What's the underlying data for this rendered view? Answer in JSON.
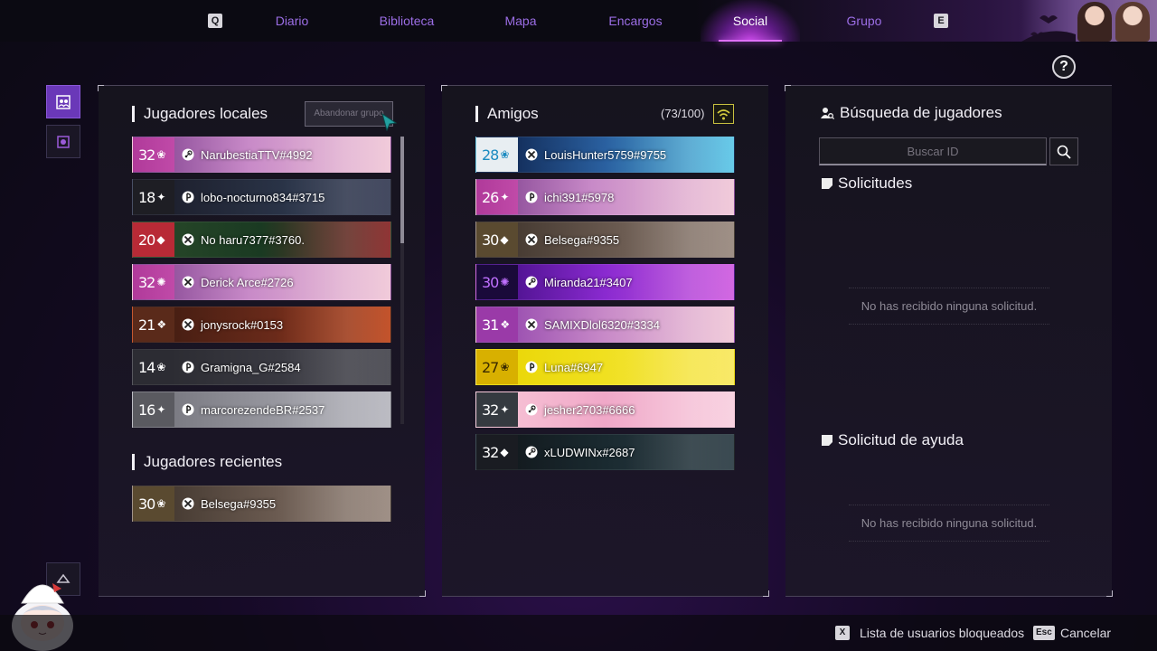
{
  "nav": {
    "left_key": "Q",
    "right_key": "E",
    "tabs": [
      {
        "label": "Diario"
      },
      {
        "label": "Biblioteca"
      },
      {
        "label": "Mapa"
      },
      {
        "label": "Encargos"
      },
      {
        "label": "Social",
        "active": true
      },
      {
        "label": "Grupo"
      }
    ]
  },
  "help": {
    "label": "?"
  },
  "local": {
    "title": "Jugadores locales",
    "leave_group_label": "Abandonar grupo",
    "players": [
      {
        "level": "32",
        "name": "NarubestiaTTV#4992",
        "platform": "steam",
        "theme": "pink"
      },
      {
        "level": "18",
        "name": "lobo-nocturno834#3715",
        "platform": "playstation",
        "theme": "dark"
      },
      {
        "level": "20",
        "name": "No haru7377#3760.",
        "platform": "xbox",
        "theme": "red"
      },
      {
        "level": "32",
        "name": "Derick Arce#2726",
        "platform": "xbox",
        "theme": "pink"
      },
      {
        "level": "21",
        "name": "jonysrock#0153",
        "platform": "xbox",
        "theme": "brown"
      },
      {
        "level": "14",
        "name": "Gramigna_G#2584",
        "platform": "playstation",
        "theme": "gray"
      },
      {
        "level": "16",
        "name": "marcorezendeBR#2537",
        "platform": "playstation",
        "theme": "lightgray"
      }
    ]
  },
  "recent": {
    "title": "Jugadores recientes",
    "players": [
      {
        "level": "30",
        "name": "Belsega#9355",
        "platform": "xbox",
        "theme": "tan"
      }
    ]
  },
  "friends": {
    "title": "Amigos",
    "count": "(73/100)",
    "players": [
      {
        "level": "28",
        "name": "LouisHunter5759#9755",
        "platform": "xbox",
        "theme": "white"
      },
      {
        "level": "26",
        "name": "ichi391#5978",
        "platform": "playstation",
        "theme": "pink"
      },
      {
        "level": "30",
        "name": "Belsega#9355",
        "platform": "xbox",
        "theme": "tan"
      },
      {
        "level": "30",
        "name": "Miranda21#3407",
        "platform": "steam",
        "theme": "purple"
      },
      {
        "level": "31",
        "name": "SAMIXDlol6320#3334",
        "platform": "xbox",
        "theme": "violet"
      },
      {
        "level": "27",
        "name": "Luna#6947",
        "platform": "playstation",
        "theme": "yellow"
      },
      {
        "level": "32",
        "name": "jesher2703#6666",
        "platform": "steam",
        "theme": "teal"
      },
      {
        "level": "32",
        "name": "xLUDWINx#2687",
        "platform": "steam",
        "theme": "black"
      }
    ]
  },
  "search": {
    "title": "Búsqueda de jugadores",
    "placeholder": "Buscar ID",
    "requests_title": "Solicitudes",
    "requests_empty": "No has recibido ninguna solicitud.",
    "help_title": "Solicitud de ayuda",
    "help_empty": "No has recibido ninguna solicitud."
  },
  "footer": {
    "blocked_key": "X",
    "blocked_label": "Lista de usuarios bloqueados",
    "cancel_key": "Esc",
    "cancel_label": "Cancelar"
  },
  "colors": {
    "accent": "#9c6ee6",
    "active_tab": "#e070ff",
    "wifi": "#c8c040"
  }
}
